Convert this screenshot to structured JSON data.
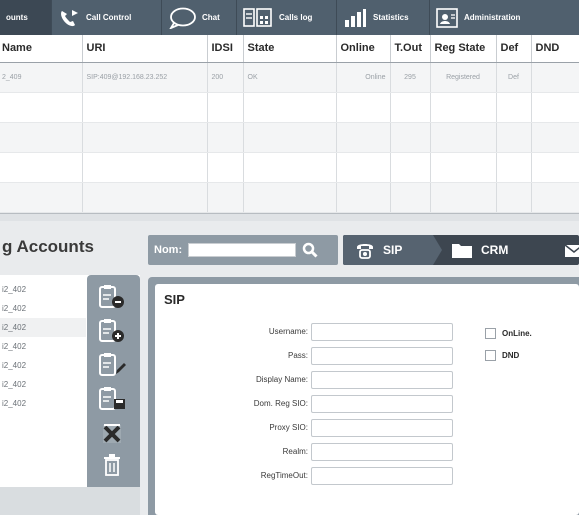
{
  "topbar": {
    "tabs": [
      {
        "label": "ounts",
        "icon": "none"
      },
      {
        "label": "Call Control",
        "icon": "call-control-icon"
      },
      {
        "label": "Chat",
        "icon": "chat-bubble-icon"
      },
      {
        "label": "Calls log",
        "icon": "calls-log-icon"
      },
      {
        "label": "Statistics",
        "icon": "bar-chart-icon"
      },
      {
        "label": "Administration",
        "icon": "admin-icon"
      }
    ]
  },
  "accounts_table": {
    "headers": [
      "Name",
      "URI",
      "IDSI",
      "State",
      "Online",
      "T.Out",
      "Reg State",
      "Def",
      "DND"
    ],
    "rows": [
      [
        "2_409",
        "SIP:409@192.168.23.252",
        "200",
        "OK",
        "Online",
        "295",
        "Registered",
        "Def",
        ""
      ],
      [
        "",
        "",
        "",
        "",
        "",
        "",
        "",
        "",
        ""
      ],
      [
        "",
        "",
        "",
        "",
        "",
        "",
        "",
        "",
        ""
      ],
      [
        "",
        "",
        "",
        "",
        "",
        "",
        "",
        "",
        ""
      ],
      [
        "",
        "",
        "",
        "",
        "",
        "",
        "",
        "",
        ""
      ]
    ]
  },
  "left_panel": {
    "title": "g Accounts",
    "accounts": [
      "i2_402",
      "i2_402",
      "i2_402",
      "i2_402",
      "i2_402",
      "i2_402",
      "i2_402"
    ]
  },
  "nav": {
    "search_label": "Nom:",
    "search_value": "",
    "crumbs": [
      "SIP",
      "CRM"
    ]
  },
  "sip_form": {
    "title": "SIP",
    "fields": [
      {
        "label": "Username:",
        "value": ""
      },
      {
        "label": "Pass:",
        "value": ""
      },
      {
        "label": "Display Name:",
        "value": ""
      },
      {
        "label": "Dom. Reg SIO:",
        "value": ""
      },
      {
        "label": "Proxy SIO:",
        "value": ""
      },
      {
        "label": "Realm:",
        "value": ""
      },
      {
        "label": "RegTimeOut:",
        "value": ""
      }
    ],
    "checkboxes": [
      {
        "label": "OnLine.",
        "checked": false
      },
      {
        "label": "DND",
        "checked": false
      }
    ]
  },
  "colors": {
    "toolbar": "#50606e",
    "panel": "#8e9aa4",
    "nav_dark": "#3d4650"
  }
}
